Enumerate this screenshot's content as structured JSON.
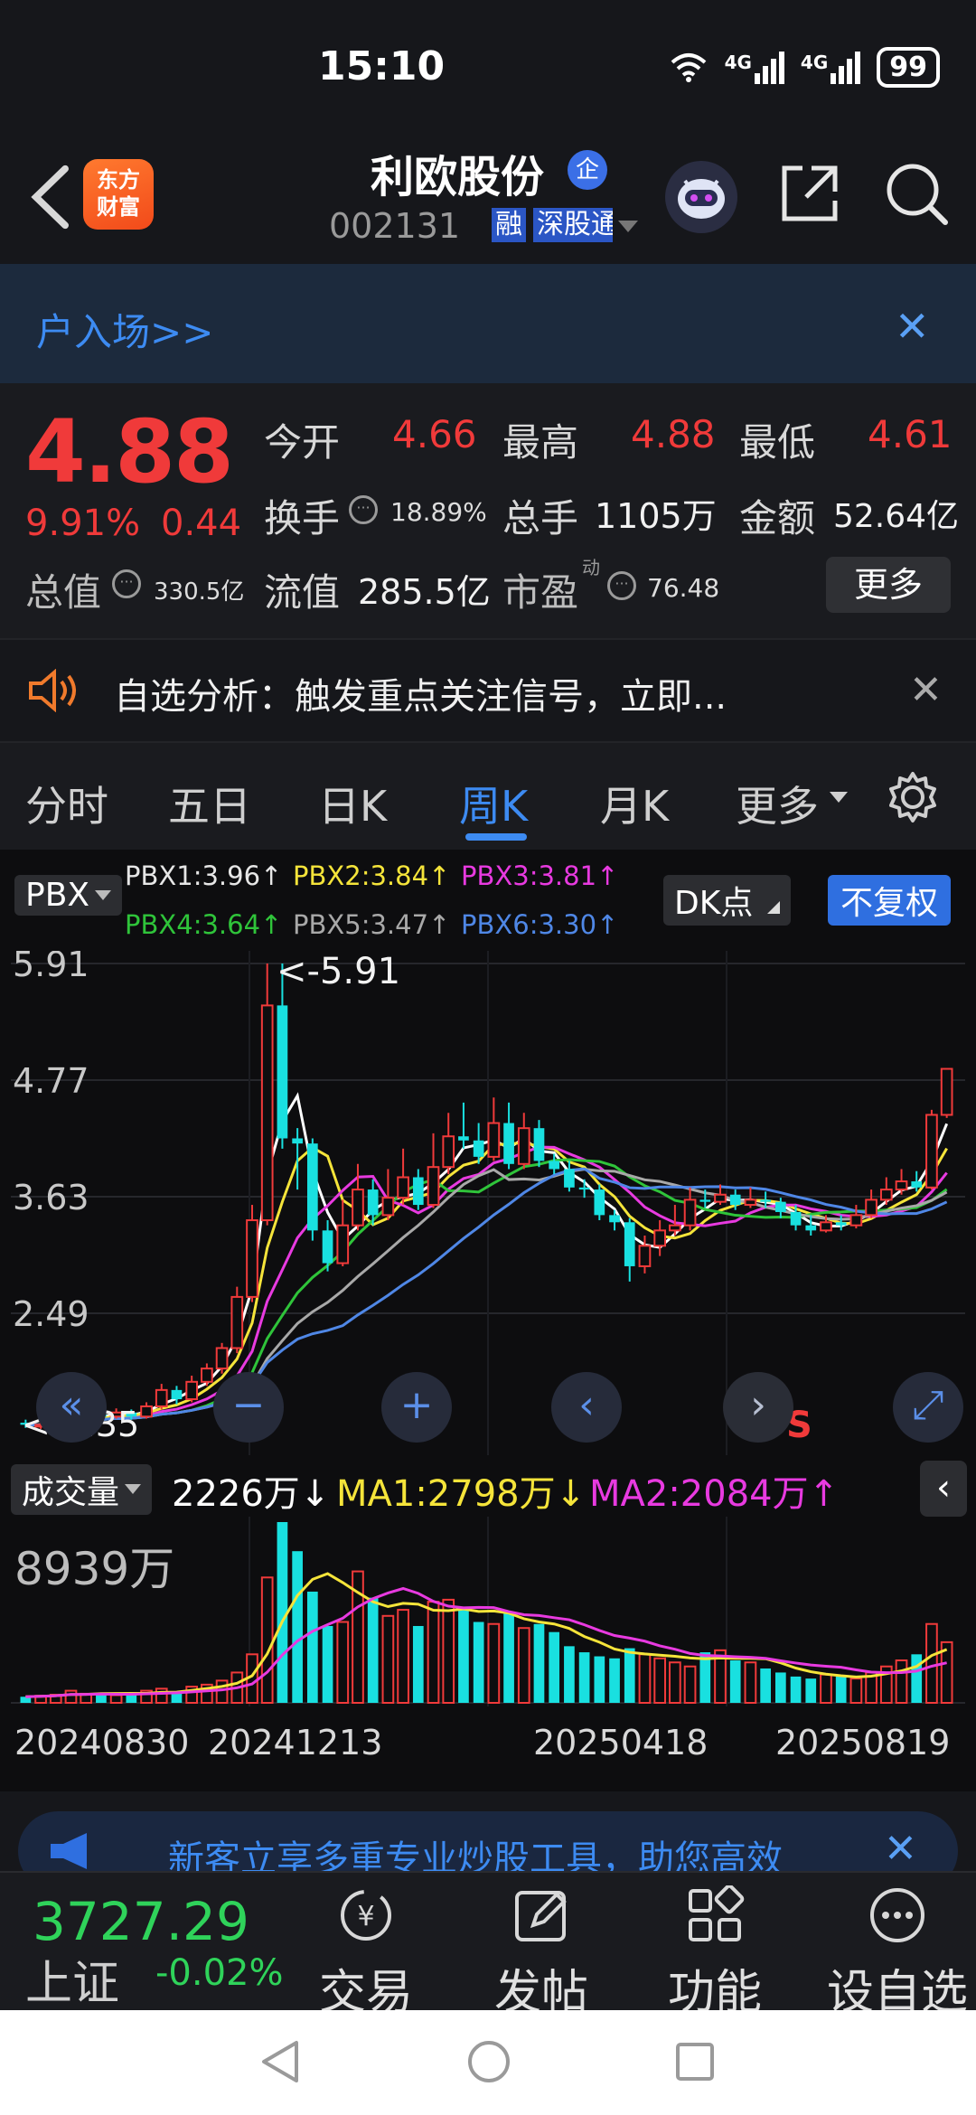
{
  "status_bar": {
    "time": "15:10",
    "battery": "99",
    "net1": "4G",
    "net2": "4G"
  },
  "header": {
    "app_logo": "东方\n财富",
    "stock_name": "利欧股份",
    "corp_badge": "企",
    "stock_code": "002131",
    "tags": [
      "融",
      "深股通"
    ]
  },
  "banner": {
    "text": "户入场>>"
  },
  "quote": {
    "price": "4.88",
    "change_pct": "9.91%",
    "change": "0.44",
    "fields": [
      {
        "label": "今开",
        "value": "4.66"
      },
      {
        "label": "最高",
        "value": "4.88"
      },
      {
        "label": "最低",
        "value": "4.61"
      },
      {
        "label": "换手",
        "value": "18.89%"
      },
      {
        "label": "总手",
        "value": "1105万"
      },
      {
        "label": "金额",
        "value": "52.64亿"
      },
      {
        "label": "总值",
        "value": "330.5亿"
      },
      {
        "label": "流值",
        "value": "285.5亿"
      },
      {
        "label": "市盈",
        "sup": "动",
        "value": "76.48"
      }
    ],
    "more_label": "更多"
  },
  "alert": {
    "text": "自选分析：触发重点关注信号，立即..."
  },
  "tabs": [
    "分时",
    "五日",
    "日K",
    "周K",
    "月K",
    "更多"
  ],
  "chart_controls": {
    "indicator": "PBX",
    "dk_label": "DK点",
    "adjust_label": "不复权",
    "pbx_values": [
      {
        "name": "PBX1:3.96↑",
        "color": "#ffffff"
      },
      {
        "name": "PBX2:3.84↑",
        "color": "#f5e43a"
      },
      {
        "name": "PBX3:3.81↑",
        "color": "#e83ae0"
      },
      {
        "name": "PBX4:3.64↑",
        "color": "#2fc43a"
      },
      {
        "name": "PBX5:3.47↑",
        "color": "#a8a8a8"
      },
      {
        "name": "PBX6:3.30↑",
        "color": "#4f87e6"
      }
    ],
    "max_marker": "<-5.91",
    "min_marker": "<-1.35",
    "s_marker": "S",
    "volume_indicator": "成交量",
    "volume_values": [
      {
        "name": "2226万↓",
        "color": "#ffffff"
      },
      {
        "name": "MA1:2798万↓",
        "color": "#f5e43a"
      },
      {
        "name": "MA2:2084万↑",
        "color": "#e83ae0"
      }
    ],
    "volume_max_label": "8939万"
  },
  "chart_data": [
    {
      "type": "candlestick",
      "y_ticks": [
        "5.91",
        "4.77",
        "3.63",
        "2.49"
      ],
      "ylim": [
        1.35,
        5.91
      ],
      "x_labels": [
        "20240830",
        "20241213",
        "20250418",
        "20250819"
      ],
      "candles": [
        [
          1.42,
          1.4,
          1.45,
          1.37
        ],
        [
          1.4,
          1.4,
          1.44,
          1.36
        ],
        [
          1.4,
          1.46,
          1.48,
          1.38
        ],
        [
          1.46,
          1.47,
          1.5,
          1.43
        ],
        [
          1.47,
          1.5,
          1.54,
          1.45
        ],
        [
          1.5,
          1.48,
          1.52,
          1.44
        ],
        [
          1.48,
          1.52,
          1.56,
          1.46
        ],
        [
          1.52,
          1.48,
          1.55,
          1.45
        ],
        [
          1.48,
          1.58,
          1.62,
          1.46
        ],
        [
          1.58,
          1.74,
          1.8,
          1.55
        ],
        [
          1.74,
          1.65,
          1.78,
          1.6
        ],
        [
          1.65,
          1.82,
          1.88,
          1.62
        ],
        [
          1.82,
          1.95,
          2.0,
          1.78
        ],
        [
          1.95,
          2.15,
          2.2,
          1.9
        ],
        [
          2.15,
          2.65,
          2.75,
          2.1
        ],
        [
          2.65,
          3.4,
          3.55,
          2.6
        ],
        [
          3.4,
          5.5,
          5.91,
          3.35
        ],
        [
          5.5,
          4.2,
          5.91,
          4.1
        ],
        [
          4.2,
          4.15,
          4.3,
          3.7
        ],
        [
          4.15,
          3.3,
          4.2,
          3.2
        ],
        [
          3.3,
          2.98,
          3.4,
          2.9
        ],
        [
          2.98,
          3.35,
          3.6,
          2.95
        ],
        [
          3.35,
          3.7,
          3.95,
          3.3
        ],
        [
          3.7,
          3.45,
          3.8,
          3.35
        ],
        [
          3.45,
          3.62,
          3.9,
          3.4
        ],
        [
          3.62,
          3.82,
          4.1,
          3.55
        ],
        [
          3.82,
          3.55,
          3.9,
          3.5
        ],
        [
          3.55,
          3.92,
          4.25,
          3.52
        ],
        [
          3.92,
          4.22,
          4.45,
          3.85
        ],
        [
          4.22,
          4.18,
          4.55,
          4.1
        ],
        [
          4.18,
          4.02,
          4.35,
          3.95
        ],
        [
          4.02,
          4.35,
          4.6,
          3.98
        ],
        [
          4.35,
          3.95,
          4.55,
          3.9
        ],
        [
          3.95,
          4.3,
          4.45,
          3.9
        ],
        [
          4.3,
          3.98,
          4.38,
          3.92
        ],
        [
          3.98,
          3.9,
          4.05,
          3.85
        ],
        [
          3.9,
          3.72,
          3.98,
          3.68
        ],
        [
          3.72,
          3.7,
          3.8,
          3.62
        ],
        [
          3.7,
          3.45,
          3.75,
          3.4
        ],
        [
          3.45,
          3.38,
          3.5,
          3.3
        ],
        [
          3.38,
          2.95,
          3.42,
          2.8
        ],
        [
          2.95,
          3.15,
          3.25,
          2.88
        ],
        [
          3.15,
          3.3,
          3.4,
          3.05
        ],
        [
          3.3,
          3.35,
          3.55,
          3.25
        ],
        [
          3.35,
          3.6,
          3.72,
          3.3
        ],
        [
          3.6,
          3.58,
          3.7,
          3.52
        ],
        [
          3.58,
          3.65,
          3.75,
          3.55
        ],
        [
          3.65,
          3.55,
          3.7,
          3.5
        ],
        [
          3.55,
          3.6,
          3.72,
          3.52
        ],
        [
          3.6,
          3.58,
          3.68,
          3.52
        ],
        [
          3.58,
          3.48,
          3.62,
          3.42
        ],
        [
          3.48,
          3.35,
          3.55,
          3.3
        ],
        [
          3.35,
          3.3,
          3.45,
          3.25
        ],
        [
          3.3,
          3.38,
          3.45,
          3.28
        ],
        [
          3.38,
          3.35,
          3.45,
          3.3
        ],
        [
          3.35,
          3.45,
          3.55,
          3.32
        ],
        [
          3.45,
          3.6,
          3.7,
          3.42
        ],
        [
          3.6,
          3.7,
          3.82,
          3.55
        ],
        [
          3.7,
          3.78,
          3.9,
          3.65
        ],
        [
          3.78,
          3.72,
          3.88,
          3.68
        ],
        [
          3.72,
          4.43,
          4.48,
          3.7
        ],
        [
          4.43,
          4.88,
          4.88,
          4.4
        ]
      ],
      "series": [
        {
          "name": "PBX1",
          "color": "#ffffff"
        },
        {
          "name": "PBX2",
          "color": "#f5e43a"
        },
        {
          "name": "PBX3",
          "color": "#e83ae0"
        },
        {
          "name": "PBX4",
          "color": "#2fc43a"
        },
        {
          "name": "PBX5",
          "color": "#a8a8a8"
        },
        {
          "name": "PBX6",
          "color": "#4f87e6"
        }
      ]
    },
    {
      "type": "bar",
      "ylim": [
        0,
        8939
      ],
      "max_label": "8939万",
      "values": [
        300,
        350,
        400,
        600,
        450,
        500,
        380,
        420,
        600,
        700,
        550,
        800,
        900,
        1100,
        1500,
        2400,
        6200,
        8939,
        7500,
        5500,
        3800,
        4000,
        6500,
        5200,
        4300,
        4600,
        3800,
        5000,
        5100,
        4700,
        4000,
        3900,
        4500,
        3700,
        3900,
        3500,
        2800,
        2500,
        2300,
        2200,
        2700,
        2400,
        2200,
        2000,
        1800,
        2500,
        2600,
        2100,
        2000,
        1700,
        1500,
        1300,
        1200,
        1400,
        1300,
        1200,
        1500,
        1800,
        2100,
        2400,
        3900,
        3000
      ],
      "ma1_color": "#f5e43a",
      "ma2_color": "#e83ae0"
    }
  ],
  "promo": {
    "text": "新客立享多重专业炒股工具，助您高效"
  },
  "bottom_nav": {
    "index_value": "3727.29",
    "index_name": "上证",
    "index_change": "-0.02%",
    "items": [
      "交易",
      "发帖",
      "功能",
      "设自选"
    ]
  }
}
